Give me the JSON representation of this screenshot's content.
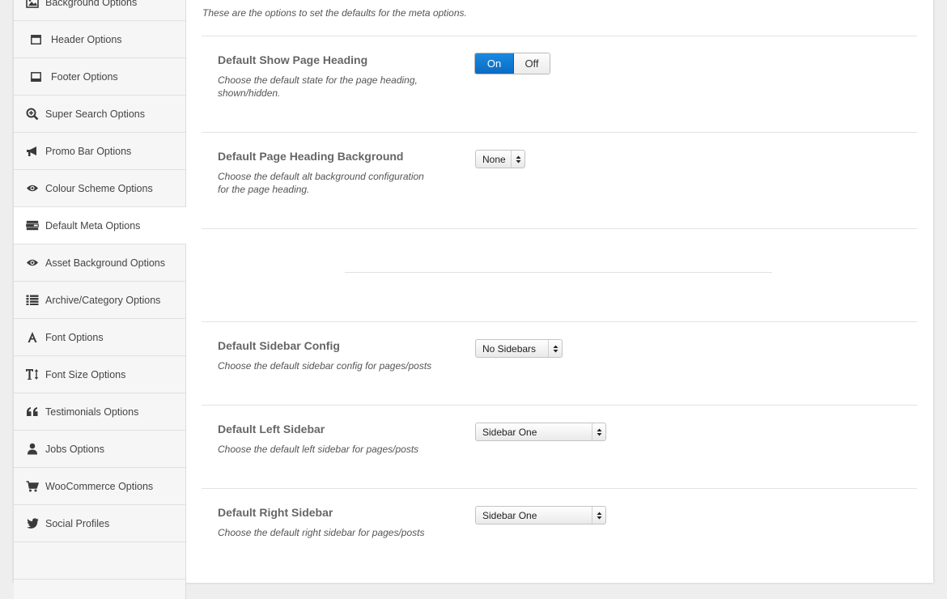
{
  "sidebar": {
    "items": [
      {
        "label": "Background Options",
        "icon": "image-icon"
      },
      {
        "label": "Header Options",
        "icon": "header-window-icon"
      },
      {
        "label": "Footer Options",
        "icon": "footer-window-icon"
      },
      {
        "label": "Super Search Options",
        "icon": "zoom-in-icon"
      },
      {
        "label": "Promo Bar Options",
        "icon": "megaphone-icon"
      },
      {
        "label": "Colour Scheme Options",
        "icon": "eye-icon"
      },
      {
        "label": "Default Meta Options",
        "icon": "tasks-icon"
      },
      {
        "label": "Asset Background Options",
        "icon": "eye-icon"
      },
      {
        "label": "Archive/Category Options",
        "icon": "list-icon"
      },
      {
        "label": "Font Options",
        "icon": "font-icon"
      },
      {
        "label": "Font Size Options",
        "icon": "text-height-icon"
      },
      {
        "label": "Testimonials Options",
        "icon": "quote-icon"
      },
      {
        "label": "Jobs Options",
        "icon": "user-icon"
      },
      {
        "label": "WooCommerce Options",
        "icon": "cart-icon"
      },
      {
        "label": "Social Profiles",
        "icon": "twitter-icon"
      }
    ],
    "active_index": 6
  },
  "main": {
    "intro": "These are the options to set the defaults for the meta options.",
    "options": {
      "show_heading": {
        "title": "Default Show Page Heading",
        "desc_line1": "Choose the default state for the page heading,",
        "desc_line2": "shown/hidden.",
        "on_label": "On",
        "off_label": "Off",
        "value": "On"
      },
      "heading_bg": {
        "title": "Default Page Heading Background",
        "desc_line1": "Choose the default alt background configuration",
        "desc_line2": "for the page heading.",
        "value": "None"
      },
      "sidebar_config": {
        "title": "Default Sidebar Config",
        "desc": "Choose the default sidebar config for pages/posts",
        "value": "No Sidebars"
      },
      "left_sidebar": {
        "title": "Default Left Sidebar",
        "desc": "Choose the default left sidebar for pages/posts",
        "value": "Sidebar One"
      },
      "right_sidebar": {
        "title": "Default Right Sidebar",
        "desc": "Choose the default right sidebar for pages/posts",
        "value": "Sidebar One"
      }
    }
  },
  "colors": {
    "toggle_on": "#0a6bc4",
    "sidebar_bg": "#f6f6f6",
    "active_bg": "#ffffff"
  }
}
